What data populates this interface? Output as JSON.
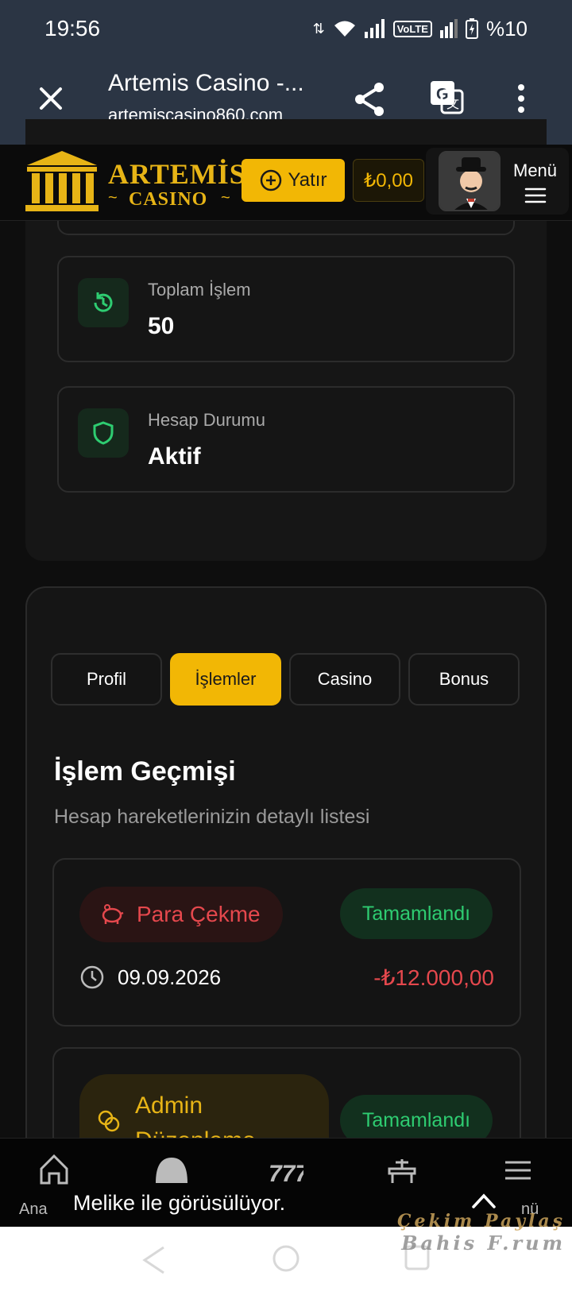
{
  "status_bar": {
    "time": "19:56",
    "network": "VoLTE",
    "battery": "%10"
  },
  "browser": {
    "title": "Artemis Casino -...",
    "url": "artemiscasino860.com"
  },
  "header": {
    "logo_line1": "ARTEMİS",
    "logo_line2": "CASINO",
    "deposit_label": "Yatır",
    "balance": "₺0,00",
    "menu_label": "Menü"
  },
  "stats": [
    {
      "label": "Toplam İşlem",
      "value": "50",
      "icon": "history-icon"
    },
    {
      "label": "Hesap Durumu",
      "value": "Aktif",
      "icon": "shield-icon"
    }
  ],
  "tabs": [
    {
      "label": "Profil",
      "active": false
    },
    {
      "label": "İşlemler",
      "active": true
    },
    {
      "label": "Casino",
      "active": false
    },
    {
      "label": "Bonus",
      "active": false
    }
  ],
  "history": {
    "title": "İşlem Geçmişi",
    "subtitle": "Hesap hareketlerinizin detaylı listesi",
    "transactions": [
      {
        "type": "Para Çekme",
        "status": "Tamamlandı",
        "date": "09.09.2026",
        "amount": "-₺12.000,00"
      },
      {
        "type": "Admin Düzenleme",
        "status": "Tamamlandı"
      }
    ]
  },
  "bottom_nav": {
    "home_label": "Ana",
    "menu_label_partial": "nü"
  },
  "toast": {
    "text": "Melike ile görüsülüyor."
  },
  "watermark": {
    "line1": "Çekim Paylaş",
    "line2": "Bahis F.rum"
  },
  "colors": {
    "accent": "#f2b705",
    "danger": "#e5484d",
    "success": "#2ecc71",
    "header_bg": "#2b3544"
  }
}
